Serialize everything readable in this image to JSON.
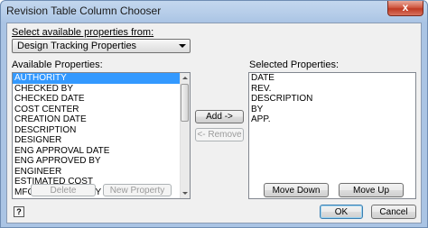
{
  "window": {
    "title": "Revision Table Column Chooser",
    "close_glyph": "x"
  },
  "dialog": {
    "source_label": "Select available properties from:",
    "source_selected": "Design Tracking Properties",
    "available_label": "Available Properties:",
    "available_items": [
      "AUTHORITY",
      "CHECKED BY",
      "CHECKED DATE",
      "COST CENTER",
      "CREATION DATE",
      "DESCRIPTION",
      "DESIGNER",
      "ENG APPROVAL DATE",
      "ENG APPROVED BY",
      "ENGINEER",
      "ESTIMATED COST",
      "MFG APPROVED BY"
    ],
    "available_selected_index": 0,
    "selected_label": "Selected Properties:",
    "selected_items": [
      "DATE",
      "REV.",
      "DESCRIPTION",
      "BY",
      "APP."
    ],
    "buttons": {
      "add": "Add ->",
      "remove": "<- Remove",
      "delete": "Delete",
      "new_property": "New Property",
      "move_down": "Move Down",
      "move_up": "Move Up",
      "ok": "OK",
      "cancel": "Cancel",
      "help": "?"
    }
  }
}
